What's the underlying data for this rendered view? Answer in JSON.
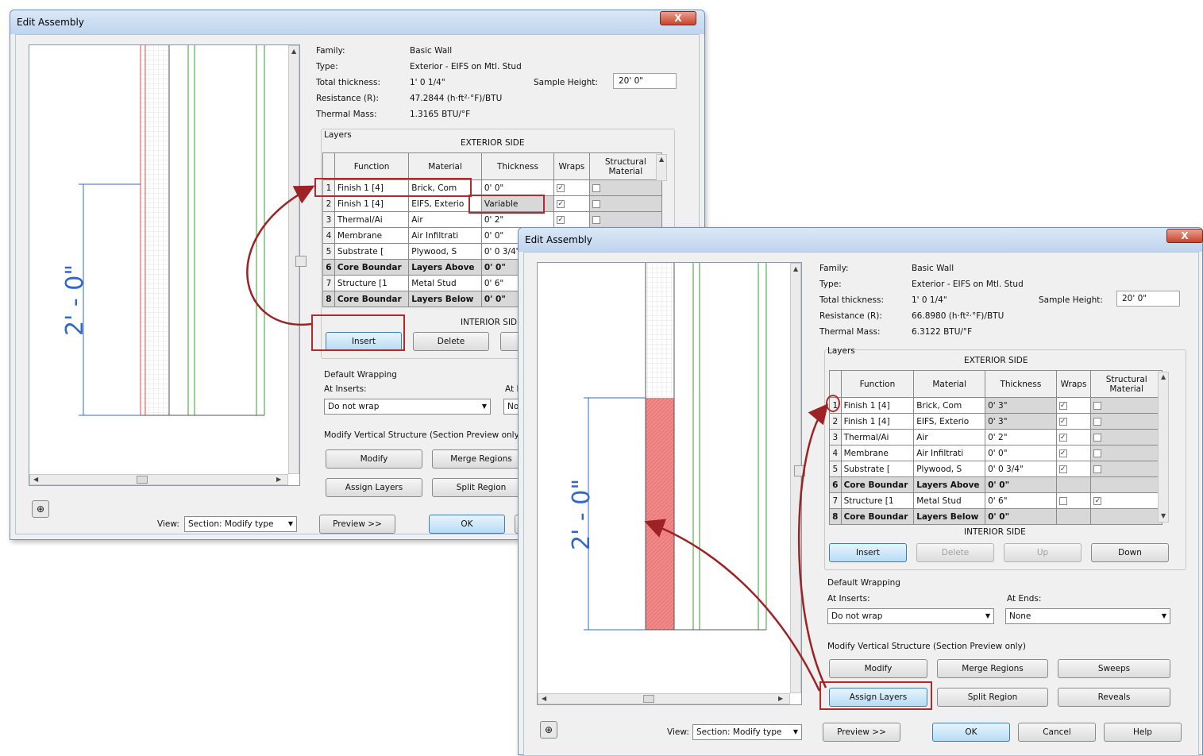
{
  "dialog": {
    "title": "Edit Assembly",
    "close_label": "X",
    "labels": {
      "family": "Family:",
      "type": "Type:",
      "total_thickness": "Total thickness:",
      "resistance": "Resistance (R):",
      "thermal_mass": "Thermal Mass:",
      "sample_height": "Sample Height:",
      "layers": "Layers",
      "exterior_side": "EXTERIOR SIDE",
      "interior_side": "INTERIOR SIDE",
      "default_wrapping": "Default Wrapping",
      "at_inserts": "At Inserts:",
      "at_ends": "At Ends:",
      "modify_vertical": "Modify Vertical Structure (Section Preview only)",
      "view": "View:"
    },
    "columns": [
      "Function",
      "Material",
      "Thickness",
      "Wraps",
      "Structural Material"
    ],
    "buttons": {
      "insert": "Insert",
      "delete": "Delete",
      "up": "Up",
      "down": "Down",
      "modify": "Modify",
      "merge_regions": "Merge Regions",
      "sweeps": "Sweeps",
      "assign_layers": "Assign Layers",
      "split_region": "Split Region",
      "reveals": "Reveals",
      "preview": "Preview >>",
      "ok": "OK",
      "cancel": "Cancel",
      "help": "Help"
    },
    "dimension_label": "2' - 0\""
  },
  "back": {
    "family": "Basic Wall",
    "type": "Exterior - EIFS on Mtl. Stud",
    "total_thickness": "1' 0 1/4\"",
    "resistance": "47.2844 (h·ft²·°F)/BTU",
    "thermal_mass": "1.3165 BTU/°F",
    "sample_height": "20' 0\"",
    "at_inserts": "Do not wrap",
    "at_ends": "None",
    "view": "Section: Modify type",
    "rows": [
      {
        "n": "1",
        "function": "Finish 1 [4]",
        "material": "Brick, Com",
        "thickness": "0' 0\"",
        "wraps": true,
        "structural": false
      },
      {
        "n": "2",
        "function": "Finish 1 [4]",
        "material": "EIFS, Exterio",
        "thickness": "Variable",
        "wraps": true,
        "structural": false
      },
      {
        "n": "3",
        "function": "Thermal/Ai",
        "material": "Air",
        "thickness": "0' 2\"",
        "wraps": true,
        "structural": false
      },
      {
        "n": "4",
        "function": "Membrane",
        "material": "Air Infiltrati",
        "thickness": "0' 0\"",
        "wraps": false,
        "structural": false
      },
      {
        "n": "5",
        "function": "Substrate [",
        "material": "Plywood, S",
        "thickness": "0' 0 3/4\"",
        "wraps": false,
        "structural": false
      },
      {
        "n": "6",
        "function": "Core Boundar",
        "material": "Layers Above",
        "thickness": "0' 0\"",
        "wraps": false,
        "structural": false
      },
      {
        "n": "7",
        "function": "Structure [1",
        "material": "Metal Stud",
        "thickness": "0' 6\"",
        "wraps": false,
        "structural": false
      },
      {
        "n": "8",
        "function": "Core Boundar",
        "material": "Layers Below",
        "thickness": "0' 0\"",
        "wraps": false,
        "structural": false
      }
    ]
  },
  "front": {
    "family": "Basic Wall",
    "type": "Exterior - EIFS on Mtl. Stud",
    "total_thickness": "1' 0 1/4\"",
    "resistance": "66.8980 (h·ft²·°F)/BTU",
    "thermal_mass": "6.3122 BTU/°F",
    "sample_height": "20' 0\"",
    "at_inserts": "Do not wrap",
    "at_ends": "None",
    "view": "Section: Modify type",
    "rows": [
      {
        "n": "1",
        "function": "Finish 1 [4]",
        "material": "Brick, Com",
        "thickness": "0' 3\"",
        "wraps": true,
        "structural": false
      },
      {
        "n": "2",
        "function": "Finish 1 [4]",
        "material": "EIFS, Exterio",
        "thickness": "0' 3\"",
        "wraps": true,
        "structural": false
      },
      {
        "n": "3",
        "function": "Thermal/Ai",
        "material": "Air",
        "thickness": "0' 2\"",
        "wraps": true,
        "structural": false
      },
      {
        "n": "4",
        "function": "Membrane",
        "material": "Air Infiltrati",
        "thickness": "0' 0\"",
        "wraps": true,
        "structural": false
      },
      {
        "n": "5",
        "function": "Substrate [",
        "material": "Plywood, S",
        "thickness": "0' 0 3/4\"",
        "wraps": true,
        "structural": false
      },
      {
        "n": "6",
        "function": "Core Boundar",
        "material": "Layers Above",
        "thickness": "0' 0\"",
        "wraps": false,
        "structural": false
      },
      {
        "n": "7",
        "function": "Structure [1",
        "material": "Metal Stud",
        "thickness": "0' 6\"",
        "wraps": false,
        "structural": true
      },
      {
        "n": "8",
        "function": "Core Boundar",
        "material": "Layers Below",
        "thickness": "0' 0\"",
        "wraps": false,
        "structural": false
      }
    ]
  },
  "colors": {
    "highlight_red": "#b5292d",
    "dimension_blue": "#3468c8",
    "assigned_layer_fill": "#f08a8a"
  }
}
